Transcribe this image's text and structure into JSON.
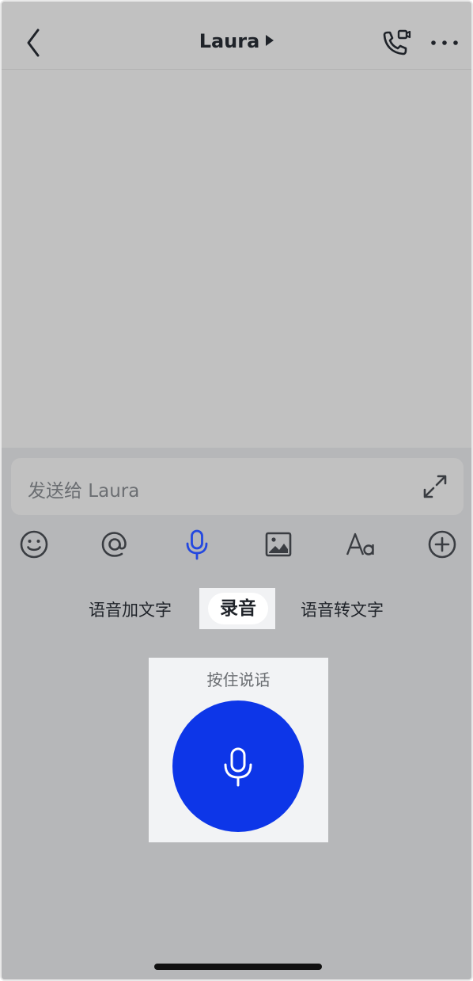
{
  "header": {
    "title": "Laura"
  },
  "input": {
    "placeholder": "发送给 Laura"
  },
  "modes": {
    "left": "语音加文字",
    "active": "录音",
    "right": "语音转文字"
  },
  "record": {
    "hold_label": "按住说话"
  },
  "colors": {
    "accent": "#0d36e8",
    "mic_active": "#2348e0",
    "icon_gray": "#3a3d42",
    "overlay_gray": "#c1c1c1"
  },
  "icons": {
    "back": "chevron-left-icon",
    "title_caret": "caret-right-icon",
    "call": "phone-video-icon",
    "more": "more-dots-icon",
    "expand": "expand-icon",
    "emoji": "emoji-icon",
    "mention": "at-icon",
    "mic": "microphone-icon",
    "image": "image-icon",
    "format": "text-format-icon",
    "add": "plus-circle-icon"
  }
}
